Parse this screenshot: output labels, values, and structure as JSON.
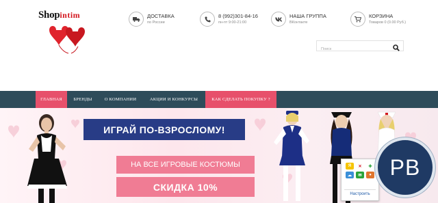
{
  "header": {
    "logo": {
      "part1": "Shop",
      "part2": "intim"
    },
    "delivery": {
      "title": "ДОСТАВКА",
      "subtitle": "по России",
      "icon": "truck-icon"
    },
    "phone": {
      "title": "8 (992)301-84-16",
      "subtitle": "пн-пт 9:00-21:00",
      "icon": "phone-icon"
    },
    "group": {
      "title": "НАША ГРУППА",
      "subtitle": "ВКонтакте",
      "icon": "vk-icon"
    },
    "cart": {
      "title": "КОРЗИНА",
      "subtitle": "Товаров 0 (0.00 Руб.)",
      "icon": "cart-icon"
    },
    "search": {
      "placeholder": "Поиск",
      "icon": "search-icon"
    }
  },
  "nav": {
    "items": [
      {
        "label": "ГЛАВНАЯ"
      },
      {
        "label": "БРЕНДЫ"
      },
      {
        "label": "О КОМПАНИИ"
      },
      {
        "label": "АКЦИИ И КОНКУРСЫ"
      },
      {
        "label": "КАК СДЕЛАТЬ ПОКУПКУ ?"
      }
    ]
  },
  "banner": {
    "headline": "ИГРАЙ ПО-ВЗРОСЛОМУ!",
    "line1": "НА ВСЕ ИГРОВЫЕ КОСТЮМЫ",
    "line2": "СКИДКА 10%"
  },
  "widget": {
    "button_label": "Настроить"
  },
  "badge": {
    "text": "PB"
  },
  "colors": {
    "nav_bg": "#2e4c5a",
    "nav_active": "#e7506b",
    "headline_bg": "#283c86",
    "promo_bg": "#f07c94",
    "logo_red": "#d2161e"
  }
}
